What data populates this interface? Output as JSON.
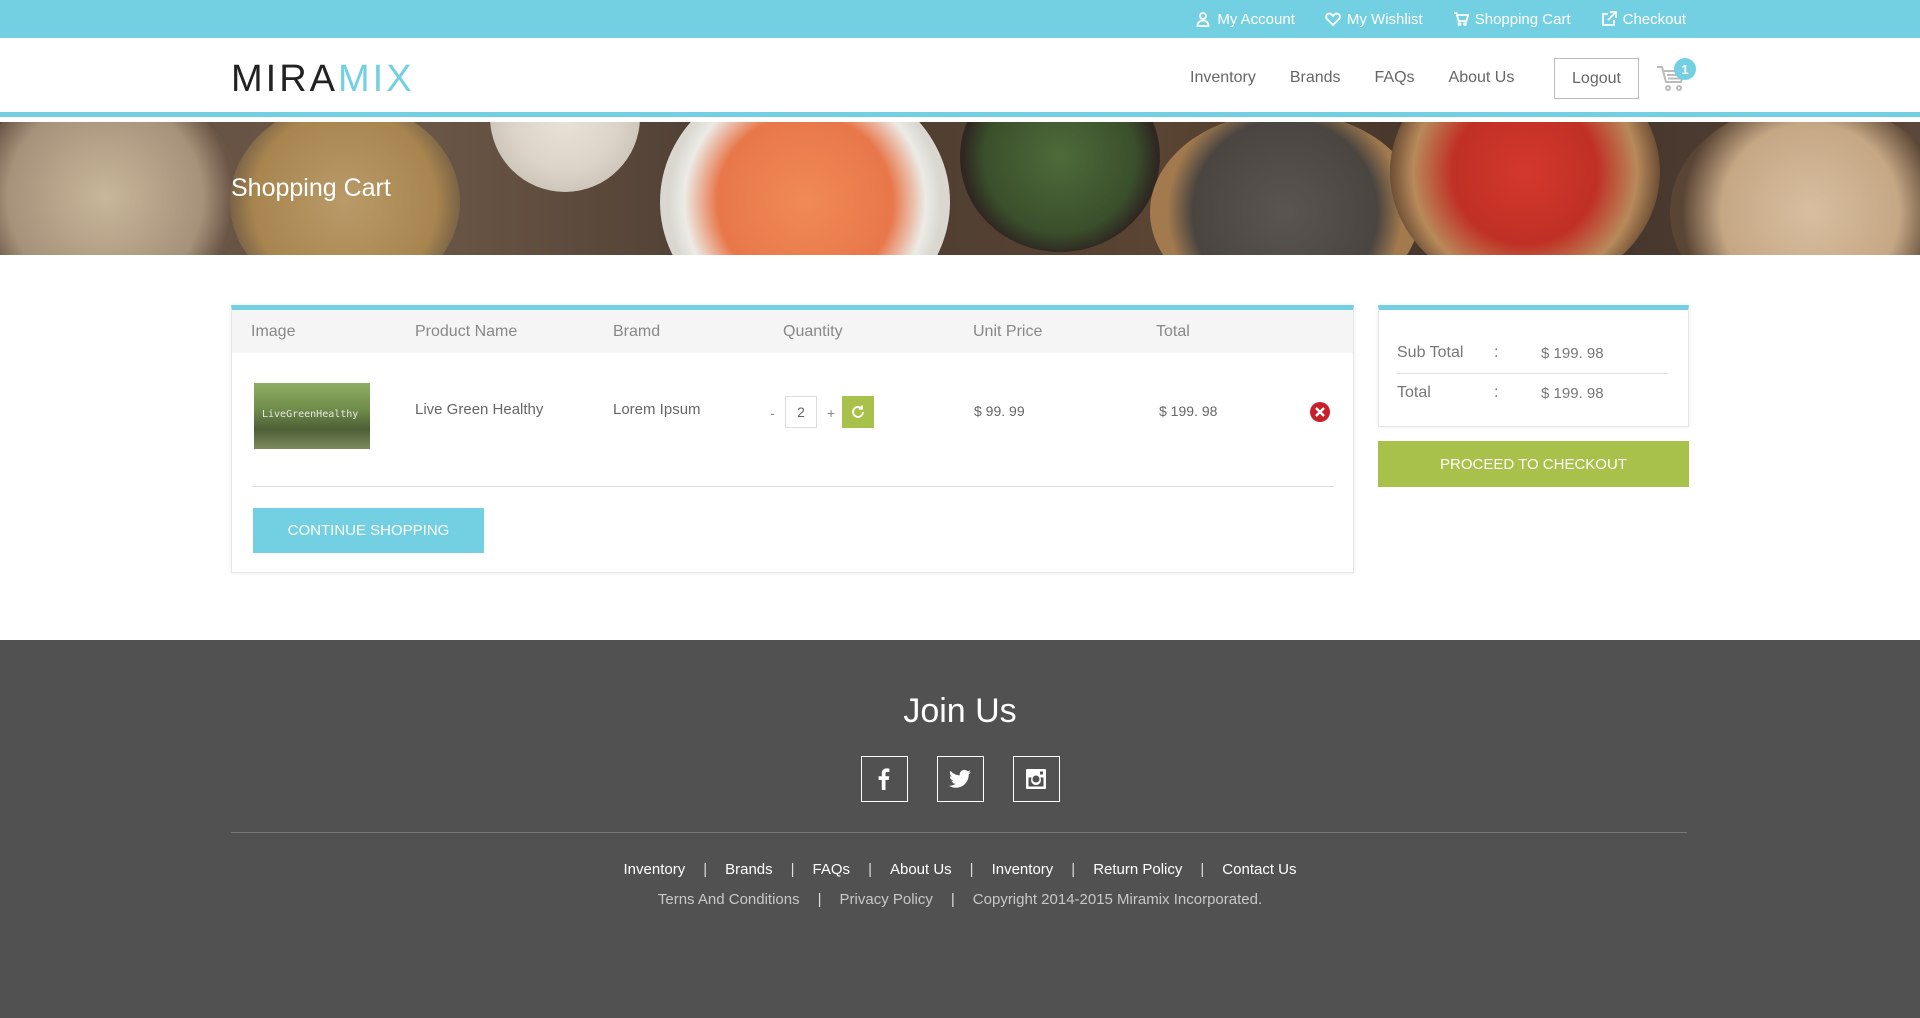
{
  "topbar": {
    "my_account": "My Account",
    "my_wishlist": "My Wishlist",
    "shopping_cart": "Shopping Cart",
    "checkout": "Checkout"
  },
  "header": {
    "logo_part1": "MIRA",
    "logo_part2": "MIX",
    "nav": [
      "Inventory",
      "Brands",
      "FAQs",
      "About Us"
    ],
    "logout_label": "Logout",
    "cart_count": "1"
  },
  "banner": {
    "title": "Shopping Cart"
  },
  "cart_table": {
    "headers": [
      "Image",
      "Product Name",
      "Bramd",
      "Quantity",
      "Unit Price",
      "Total"
    ],
    "row": {
      "image_text": "LiveGreenHealthy",
      "product_name": "Live Green Healthy",
      "brand": "Lorem Ipsum",
      "qty_minus": "-",
      "quantity": "2",
      "qty_plus": "+",
      "unit_price": "$ 99. 99",
      "total": "$ 199. 98"
    },
    "continue_label": "CONTINUE SHOPPING"
  },
  "summary": {
    "subtotal_label": "Sub Total",
    "subtotal_colon": ":",
    "subtotal_value": "$ 199. 98",
    "total_label": "Total",
    "total_colon": ":",
    "total_value": "$ 199. 98",
    "checkout_label": "PROCEED TO CHECKOUT"
  },
  "footer": {
    "join_title": "Join Us",
    "socials": [
      "facebook-icon",
      "twitter-icon",
      "instagram-icon"
    ],
    "links": [
      "Inventory",
      "Brands",
      "FAQs",
      "About Us",
      "Inventory",
      "Return Policy",
      "Contact Us"
    ],
    "separator": "|",
    "terms": "Terns And Conditions",
    "privacy": "Privacy Policy",
    "copyright": "Copyright 2014-2015 Miramix Incorporated."
  },
  "colors": {
    "accent_blue": "#72d0e2",
    "accent_green": "#a8c14a",
    "footer_bg": "#515151",
    "remove_red": "#c8202a"
  }
}
